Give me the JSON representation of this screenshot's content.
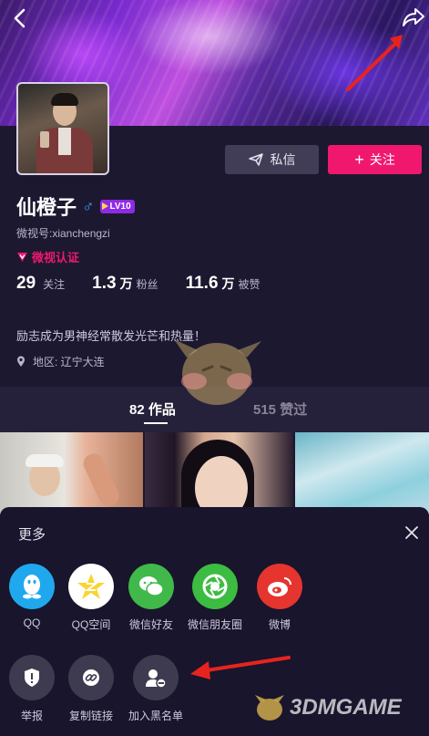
{
  "colors": {
    "accent": "#f0186e",
    "background": "#1c1830",
    "sheet_background": "#18152c",
    "muted_text": "#bcb6cc",
    "gender_blue": "#3aa0ff",
    "level_purple": "#8e2ae6",
    "annotation_red": "#e8231f"
  },
  "header": {
    "back_icon": "chevron-left-icon",
    "share_icon": "share-arrow-icon"
  },
  "profile": {
    "dm_label": "私信",
    "follow_label": "关注",
    "follow_prefix": "+",
    "name": "仙橙子",
    "gender_symbol": "♂",
    "level": "LV10",
    "weishi_id": "微视号:xianchengzi",
    "cert": "微视认证",
    "stats": [
      {
        "num": "29",
        "unit": "",
        "label": "关注"
      },
      {
        "num": "1.3",
        "unit": "万",
        "label": "粉丝"
      },
      {
        "num": "11.6",
        "unit": "万",
        "label": "被赞"
      }
    ],
    "bio": "励志成为男神经常散发光芒和热量！",
    "location": "地区: 辽宁大连"
  },
  "tabs": {
    "works": "82 作品",
    "liked": "515 赞过"
  },
  "sheet": {
    "title": "更多",
    "share_targets": [
      {
        "label": "QQ",
        "icon": "qq-penguin-icon",
        "color": "#20a8ef"
      },
      {
        "label": "QQ空间",
        "icon": "qzone-star-icon",
        "color": "#fbd42c"
      },
      {
        "label": "微信好友",
        "icon": "wechat-icon",
        "color": "#40b94a"
      },
      {
        "label": "微信朋友圈",
        "icon": "moments-icon",
        "color": "#3cbc40"
      },
      {
        "label": "微博",
        "icon": "weibo-icon",
        "color": "#e6342f"
      }
    ],
    "actions": [
      {
        "label": "举报",
        "icon": "report-shield-icon"
      },
      {
        "label": "复制链接",
        "icon": "link-icon"
      },
      {
        "label": "加入黑名单",
        "icon": "block-user-icon"
      }
    ]
  },
  "watermark": "3DMGAME"
}
